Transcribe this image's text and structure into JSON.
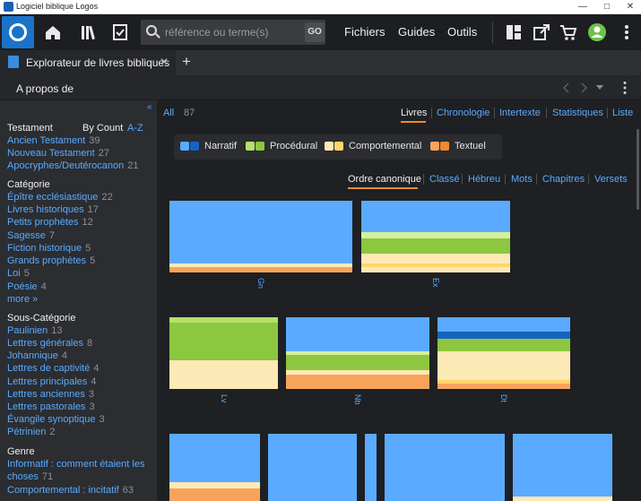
{
  "window": {
    "title": "Logiciel biblique Logos",
    "minimize": "—",
    "maximize": "□",
    "close": "✕"
  },
  "toolbar": {
    "search_placeholder": "référence ou terme(s)",
    "go_label": "GO",
    "nav": [
      "Fichiers",
      "Guides",
      "Outils"
    ],
    "icons": [
      "home-icon",
      "library-icon",
      "checklist-icon",
      "layout-icon",
      "panel-undock-icon",
      "cart-icon",
      "avatar-icon",
      "more-icon"
    ]
  },
  "tab": {
    "label": "Explorateur de livres bibliques",
    "close": "✕",
    "add": "+"
  },
  "subheader": {
    "label": "A propos de"
  },
  "sidebar": {
    "collapse": "«",
    "testament": {
      "heading": "Testament",
      "by_count": "By Count",
      "az": "A-Z",
      "items": [
        {
          "label": "Ancien Testament",
          "count": "39"
        },
        {
          "label": "Nouveau Testament",
          "count": "27"
        },
        {
          "label": "Apocryphes/Deutérocanon",
          "count": "21"
        }
      ]
    },
    "categorie": {
      "heading": "Catégorie",
      "items": [
        {
          "label": "Épître ecclésiastique",
          "count": "22"
        },
        {
          "label": "Livres historiques",
          "count": "17"
        },
        {
          "label": "Petits prophètes",
          "count": "12"
        },
        {
          "label": "Sagesse",
          "count": "7"
        },
        {
          "label": "Fiction historique",
          "count": "5"
        },
        {
          "label": "Grands prophètes",
          "count": "5"
        },
        {
          "label": "Loi",
          "count": "5"
        },
        {
          "label": "Poésie",
          "count": "4"
        }
      ],
      "more": "more »"
    },
    "sous_categorie": {
      "heading": "Sous-Catégorie",
      "items": [
        {
          "label": "Paulinien",
          "count": "13"
        },
        {
          "label": "Lettres générales",
          "count": "8"
        },
        {
          "label": "Johannique",
          "count": "4"
        },
        {
          "label": "Lettres de captivité",
          "count": "4"
        },
        {
          "label": "Lettres principales",
          "count": "4"
        },
        {
          "label": "Lettres anciennes",
          "count": "3"
        },
        {
          "label": "Lettres pastorales",
          "count": "3"
        },
        {
          "label": "Évangile synoptique",
          "count": "3"
        },
        {
          "label": "Pétrinien",
          "count": "2"
        }
      ]
    },
    "genre": {
      "heading": "Genre",
      "items": [
        {
          "label": "Informatif : comment étaient les",
          "label2": "choses",
          "count": "71"
        },
        {
          "label": "Comportemental : incitatif",
          "count": "63"
        }
      ]
    }
  },
  "main": {
    "filter": {
      "label": "All",
      "count": "87"
    },
    "views": [
      "Livres",
      "Chronologie",
      "Intertexte",
      "Statistiques",
      "Liste"
    ],
    "active_view": "Livres",
    "legend": [
      {
        "label": "Narratif",
        "colors": [
          "#5aabff",
          "#1565c0"
        ]
      },
      {
        "label": "Procédural",
        "colors": [
          "#b5e06b",
          "#8dc63f"
        ]
      },
      {
        "label": "Comportemental",
        "colors": [
          "#fde9b5",
          "#ffd56b"
        ]
      },
      {
        "label": "Textuel",
        "colors": [
          "#f7a35c",
          "#f08a2c"
        ]
      }
    ],
    "sorts": [
      "Ordre canonique",
      "Classé",
      "Hébreu",
      "Mots",
      "Chapitres",
      "Versets"
    ],
    "active_sort": "Ordre canonique",
    "books": [
      {
        "label": "Gn",
        "segments": [
          {
            "color": "#5aabff",
            "frac": 0.88
          },
          {
            "color": "#fde9b5",
            "frac": 0.04
          },
          {
            "color": "#f7a35c",
            "frac": 0.08
          }
        ]
      },
      {
        "label": "Ex",
        "segments": [
          {
            "color": "#5aabff",
            "frac": 0.44
          },
          {
            "color": "#d6ef9f",
            "frac": 0.08
          },
          {
            "color": "#8dc63f",
            "frac": 0.22
          },
          {
            "color": "#fde9b5",
            "frac": 0.14
          },
          {
            "color": "#ffd56b",
            "frac": 0.04
          },
          {
            "color": "#fde9b5",
            "frac": 0.08
          }
        ]
      },
      {
        "label": "Lv",
        "segments": [
          {
            "color": "#b5e06b",
            "frac": 0.08
          },
          {
            "color": "#8dc63f",
            "frac": 0.52
          },
          {
            "color": "#fde9b5",
            "frac": 0.4
          }
        ]
      },
      {
        "label": "Nb",
        "segments": [
          {
            "color": "#5aabff",
            "frac": 0.47
          },
          {
            "color": "#d6ef9f",
            "frac": 0.05
          },
          {
            "color": "#8dc63f",
            "frac": 0.22
          },
          {
            "color": "#fde9b5",
            "frac": 0.06
          },
          {
            "color": "#f7a35c",
            "frac": 0.2
          }
        ]
      },
      {
        "label": "Dt",
        "segments": [
          {
            "color": "#5aabff",
            "frac": 0.2
          },
          {
            "color": "#1565c0",
            "frac": 0.1
          },
          {
            "color": "#8dc63f",
            "frac": 0.18
          },
          {
            "color": "#fde9b5",
            "frac": 0.4
          },
          {
            "color": "#ffd56b",
            "frac": 0.04
          },
          {
            "color": "#f7a35c",
            "frac": 0.08
          }
        ]
      },
      {
        "label": "",
        "segments": [
          {
            "color": "#5aabff",
            "frac": 0.68
          },
          {
            "color": "#fde9b5",
            "frac": 0.08
          },
          {
            "color": "#f7a35c",
            "frac": 0.24
          }
        ]
      },
      {
        "label": "",
        "segments": [
          {
            "color": "#5aabff",
            "frac": 0.96
          },
          {
            "color": "#f7a35c",
            "frac": 0.04
          }
        ]
      },
      {
        "label": "",
        "segments": [
          {
            "color": "#5aabff",
            "frac": 1.0
          }
        ]
      },
      {
        "label": "",
        "segments": [
          {
            "color": "#5aabff",
            "frac": 1.0
          }
        ]
      },
      {
        "label": "",
        "segments": [
          {
            "color": "#5aabff",
            "frac": 0.88
          },
          {
            "color": "#fde9b5",
            "frac": 0.06
          },
          {
            "color": "#f7a35c",
            "frac": 0.06
          }
        ]
      }
    ]
  }
}
